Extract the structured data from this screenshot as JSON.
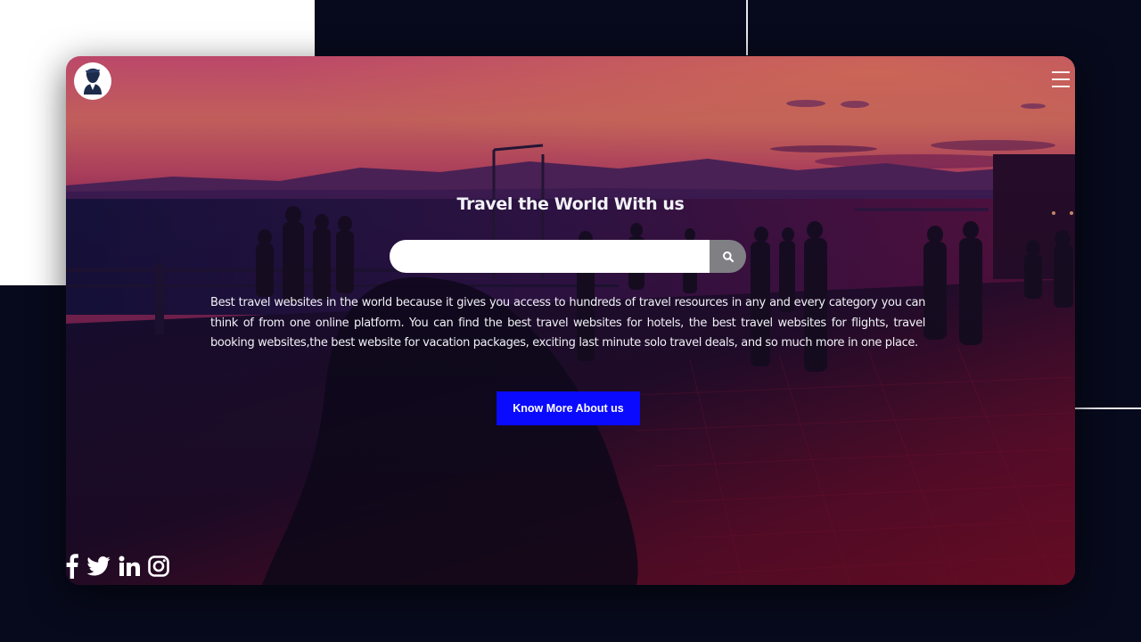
{
  "hero": {
    "title": "Travel the World With us",
    "description": "Best travel websites in the world because it gives you access to hundreds of travel resources in any and every category you can think of from one online platform. You can find the best travel websites for hotels, the best travel websites for flights, travel booking websites,the best website for vacation packages, exciting last minute solo travel deals, and so much more in one place.",
    "cta_label": "Know More About us"
  },
  "search": {
    "placeholder": "",
    "value": "",
    "button_icon": "search-icon"
  },
  "header": {
    "logo_icon": "traveler-portrait-logo",
    "menu_icon": "hamburger-menu-icon"
  },
  "social": {
    "icons": [
      "facebook-icon",
      "twitter-icon",
      "linkedin-icon",
      "instagram-icon"
    ]
  },
  "colors": {
    "page_background": "#070a1c",
    "cta_background": "#0a0aff",
    "search_button": "#7f7f84",
    "text": "#f1f1f6"
  }
}
